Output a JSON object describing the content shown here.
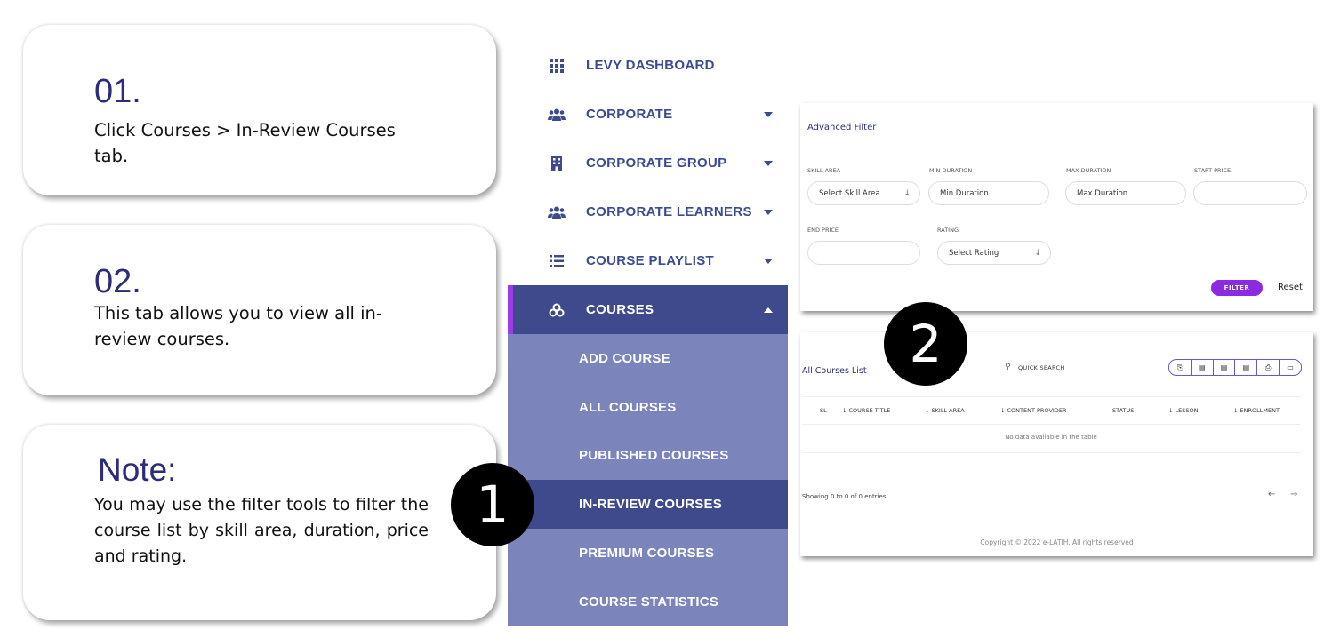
{
  "steps": [
    {
      "num": "01.",
      "text": "Click Courses > In-Review Courses tab."
    },
    {
      "num": "02.",
      "text": "This tab allows you to view all in-review courses."
    },
    {
      "num": "Note:",
      "text": "You may use the filter tools to filter the course list by skill area, duration, price and rating."
    }
  ],
  "sidebar": {
    "items": [
      {
        "label": "LEVY DASHBOARD",
        "icon": "grid-icon"
      },
      {
        "label": "CORPORATE",
        "icon": "users-icon"
      },
      {
        "label": "CORPORATE GROUP",
        "icon": "building-icon"
      },
      {
        "label": "CORPORATE LEARNERS",
        "icon": "users-icon"
      },
      {
        "label": "COURSE PLAYLIST",
        "icon": "list-icon"
      },
      {
        "label": "COURSES",
        "icon": "courses-icon"
      }
    ],
    "submenu": [
      {
        "label": "ADD COURSE"
      },
      {
        "label": "ALL COURSES"
      },
      {
        "label": "PUBLISHED COURSES"
      },
      {
        "label": "IN-REVIEW COURSES"
      },
      {
        "label": "PREMIUM COURSES"
      },
      {
        "label": "COURSE STATISTICS"
      }
    ]
  },
  "filter": {
    "title": "Advanced Filter",
    "skill_area_label": "SKILL AREA",
    "skill_area_value": "Select Skill Area",
    "min_duration_label": "MIN DURATION",
    "min_duration_value": "Min Duration",
    "max_duration_label": "MAX DURATION",
    "max_duration_value": "Max Duration",
    "start_price_label": "START PRICE.",
    "end_price_label": "END PRICE",
    "rating_label": "RATING",
    "rating_value": "Select Rating",
    "filter_button": "FILTER",
    "reset_link": "Reset"
  },
  "list": {
    "title": "All Courses List",
    "search_placeholder": "QUICK SEARCH",
    "columns": [
      "SL",
      "COURSE TITLE",
      "SKILL AREA",
      "CONTENT PROVIDER",
      "STATUS",
      "LESSON",
      "ENROLLMENT"
    ],
    "empty_message": "No data available in the table",
    "showing": "Showing 0 to 0 of 0 entries",
    "footer": "Copyright © 2022 e-LATIH. All rights reserved"
  },
  "badges": [
    "1",
    "2"
  ]
}
